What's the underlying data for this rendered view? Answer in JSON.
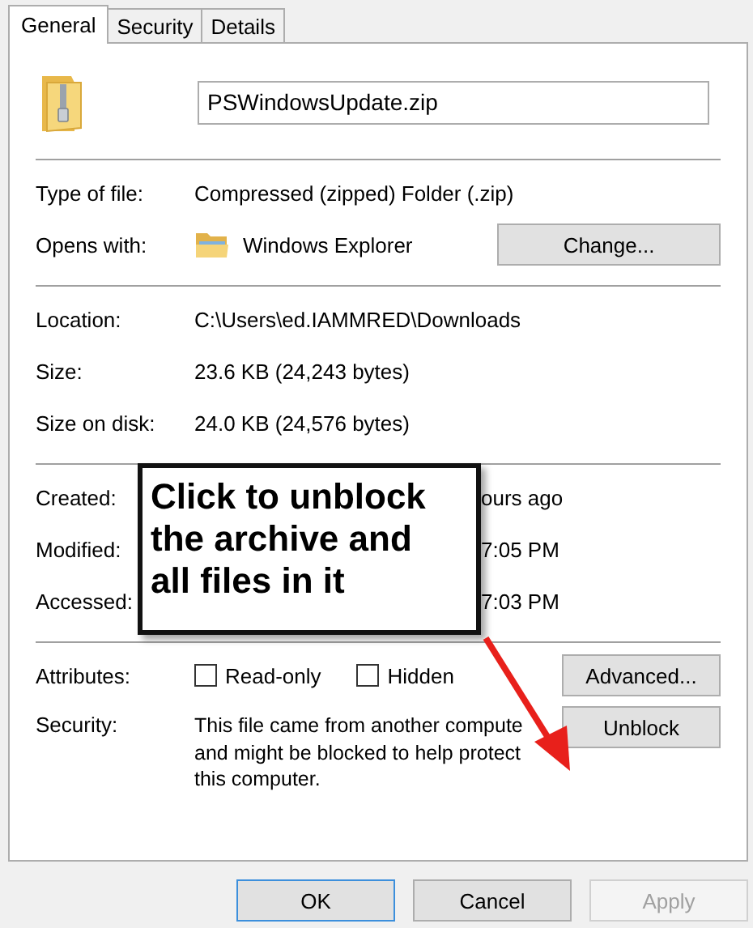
{
  "tabs": [
    {
      "label": "General",
      "selected": true
    },
    {
      "label": "Security",
      "selected": false
    },
    {
      "label": "Details",
      "selected": false
    }
  ],
  "file": {
    "name": "PSWindowsUpdate.zip"
  },
  "type_rows": [
    {
      "label": "Type of file:",
      "value": "Compressed (zipped) Folder (.zip)"
    },
    {
      "label": "Opens with:",
      "value": "Windows Explorer",
      "button": "Change..."
    }
  ],
  "location_rows": [
    {
      "label": "Location:",
      "value": "C:\\Users\\ed.IAMMRED\\Downloads"
    },
    {
      "label": "Size:",
      "value": "23.6 KB (24,243 bytes)"
    },
    {
      "label": "Size on disk:",
      "value": "24.0 KB (24,576 bytes)"
    }
  ],
  "date_rows": [
    {
      "label": "Created:",
      "value": "ours ago"
    },
    {
      "label": "Modified:",
      "value": "7:05 PM"
    },
    {
      "label": "Accessed:",
      "value": "7:03 PM"
    }
  ],
  "attributes": {
    "label": "Attributes:",
    "checkboxes": [
      {
        "label": "Read-only",
        "checked": false
      },
      {
        "label": "Hidden",
        "checked": false
      }
    ],
    "button": "Advanced..."
  },
  "security": {
    "label": "Security:",
    "lines": [
      "This file came from another compute",
      "and might be blocked to help protect",
      "this computer."
    ],
    "button": "Unblock"
  },
  "callout": {
    "lines": [
      "Click to unblock",
      "the archive and",
      "all files in it"
    ]
  },
  "buttons": [
    {
      "label": "OK",
      "default": true,
      "disabled": false
    },
    {
      "label": "Cancel",
      "default": false,
      "disabled": false
    },
    {
      "label": "Apply",
      "default": false,
      "disabled": true
    }
  ]
}
